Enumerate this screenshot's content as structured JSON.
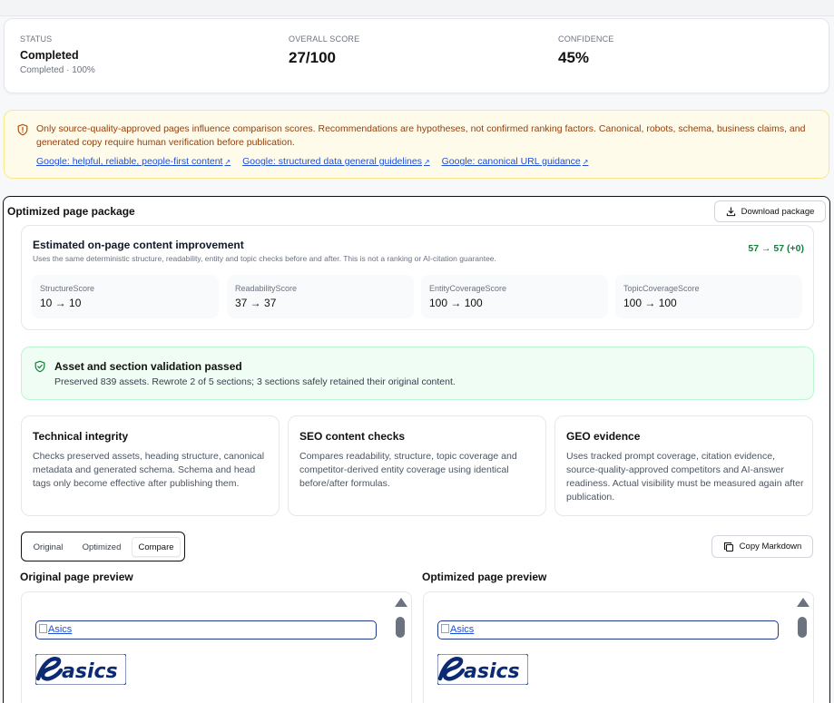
{
  "status": {
    "status_label": "STATUS",
    "status_value": "Completed",
    "status_sub": "Completed · 100%",
    "score_label": "OVERALL SCORE",
    "score_value": "27/100",
    "confidence_label": "CONFIDENCE",
    "confidence_value": "45%"
  },
  "warning": {
    "text": "Only source-quality-approved pages influence comparison scores. Recommendations are hypotheses, not confirmed ranking factors. Canonical, robots, schema, business claims, and generated copy require human verification before publication.",
    "links": [
      "Google: helpful, reliable, people-first content",
      "Google: structured data general guidelines",
      "Google: canonical URL guidance"
    ],
    "icon": "shield-alert-icon",
    "color": "#92400e"
  },
  "package": {
    "title": "Optimized page package",
    "download_label": "Download package",
    "improvement": {
      "title": "Estimated on-page content improvement",
      "description": "Uses the same deterministic structure, readability, entity and topic checks before and after. This is not a ranking or AI-citation guarantee.",
      "delta": "57 → 57 (+0)",
      "metrics": [
        {
          "label": "StructureScore",
          "value": "10 → 10"
        },
        {
          "label": "ReadabilityScore",
          "value": "37 → 37"
        },
        {
          "label": "EntityCoverageScore",
          "value": "100 → 100"
        },
        {
          "label": "TopicCoverageScore",
          "value": "100 → 100"
        }
      ]
    },
    "validation": {
      "title": "Asset and section validation passed",
      "description": "Preserved 839 assets. Rewrote 2 of 5 sections; 3 sections safely retained their original content.",
      "color": "#15803d"
    },
    "cards": [
      {
        "title": "Technical integrity",
        "text": "Checks preserved assets, heading structure, canonical metadata and generated schema. Schema and head tags only become effective after publishing them."
      },
      {
        "title": "SEO content checks",
        "text": "Compares readability, structure, topic coverage and competitor-derived entity coverage using identical before/after formulas."
      },
      {
        "title": "GEO evidence",
        "text": "Uses tracked prompt coverage, citation evidence, source-quality-approved competitors and AI-answer readiness. Actual visibility must be measured again after publication."
      }
    ],
    "tabs": [
      "Original",
      "Optimized",
      "Compare"
    ],
    "active_tab": "Compare",
    "copy_label": "Copy Markdown",
    "original_title": "Original page preview",
    "optimized_title": "Optimized page preview",
    "image_alt": "Asics",
    "logo_text": "asics"
  }
}
